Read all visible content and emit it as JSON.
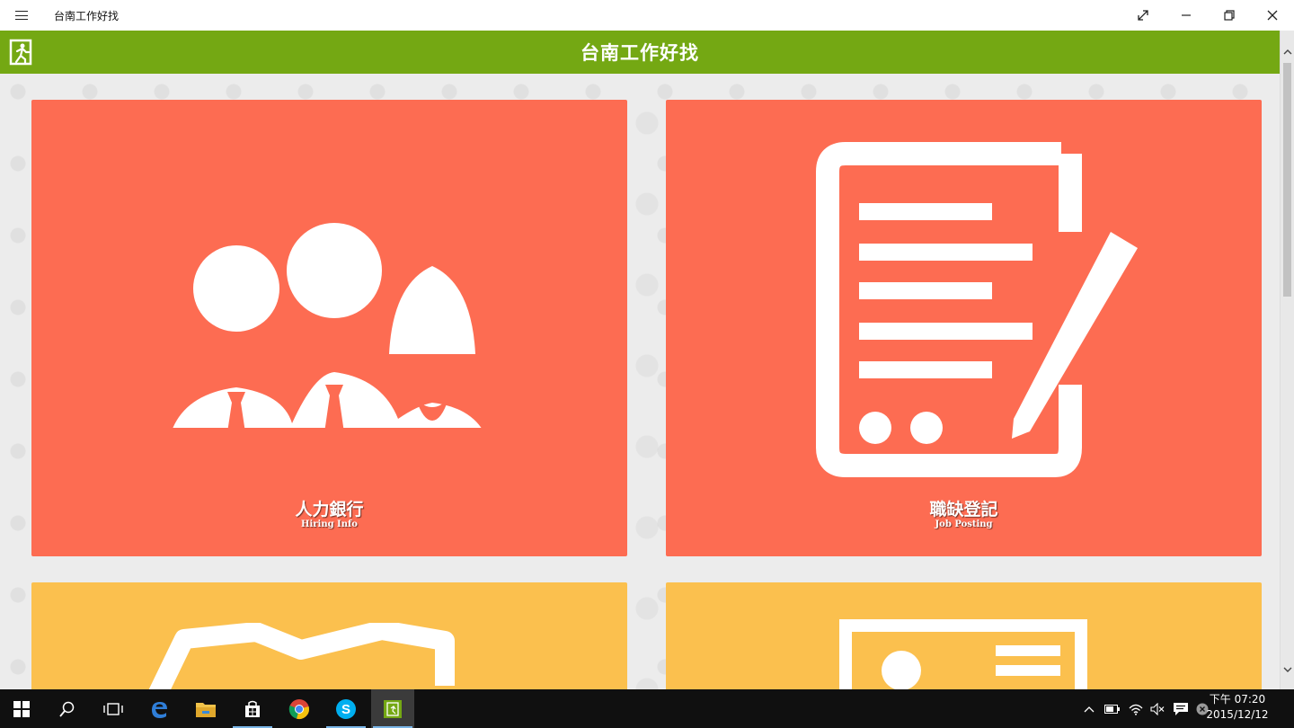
{
  "window": {
    "title": "台南工作好找"
  },
  "appbar": {
    "title": "台南工作好找"
  },
  "tiles": [
    {
      "zh": "人力銀行",
      "en": "Hiring Info",
      "color": "#fd6c52",
      "icon": "people-icon"
    },
    {
      "zh": "職缺登記",
      "en": "Job Posting",
      "color": "#fd6c52",
      "icon": "document-pen-icon"
    },
    {
      "zh": "",
      "en": "",
      "color": "#fbc04e",
      "icon": "handshake-icon"
    },
    {
      "zh": "",
      "en": "",
      "color": "#fbc04e",
      "icon": "id-card-icon"
    }
  ],
  "colors": {
    "header": "#74a813",
    "tile_red": "#fd6c52",
    "tile_yellow": "#fbc04e",
    "taskbar": "#101010"
  },
  "taskbar": {
    "clock_period_time": "下午 07:20",
    "clock_date": "2015/12/12"
  }
}
